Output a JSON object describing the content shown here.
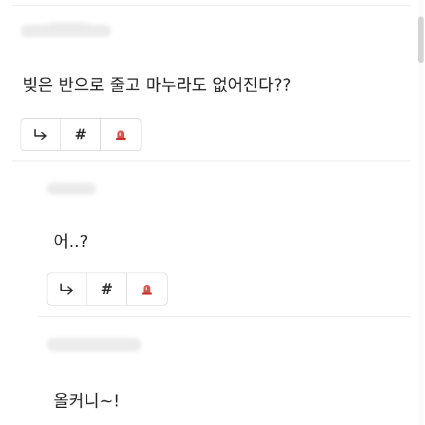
{
  "thread": {
    "comments": [
      {
        "text": "빚은 반으로 줄고 마누라도 없어진다??",
        "author_hidden": true
      },
      {
        "text": "어..?",
        "author_hidden": true
      },
      {
        "text": "올커니~!",
        "author_hidden": true
      }
    ]
  },
  "toolbar_icons": {
    "reply": "reply-arrow-icon",
    "tag": "hash-icon",
    "report": "siren-icon"
  },
  "tool_labels": {
    "hash": "#"
  },
  "colors": {
    "siren": "#d9534f",
    "border": "#d6d6d6",
    "divider": "#dcdcdc",
    "text": "#1e1e1e"
  }
}
